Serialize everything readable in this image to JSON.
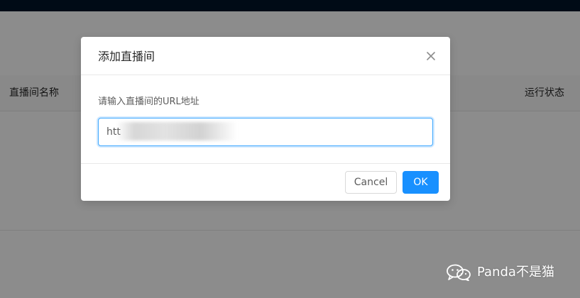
{
  "background": {
    "table_headers": [
      "直播间名称",
      "运行状态"
    ]
  },
  "modal": {
    "title": "添加直播间",
    "field_label": "请输入直播间的URL地址",
    "input_value": "htt",
    "cancel_label": "Cancel",
    "ok_label": "OK"
  },
  "watermark": {
    "text": "Panda不是猫",
    "icon": "wechat-icon"
  },
  "colors": {
    "topbar": "#001529",
    "primary": "#1890ff",
    "focus_border": "#40a9ff"
  }
}
